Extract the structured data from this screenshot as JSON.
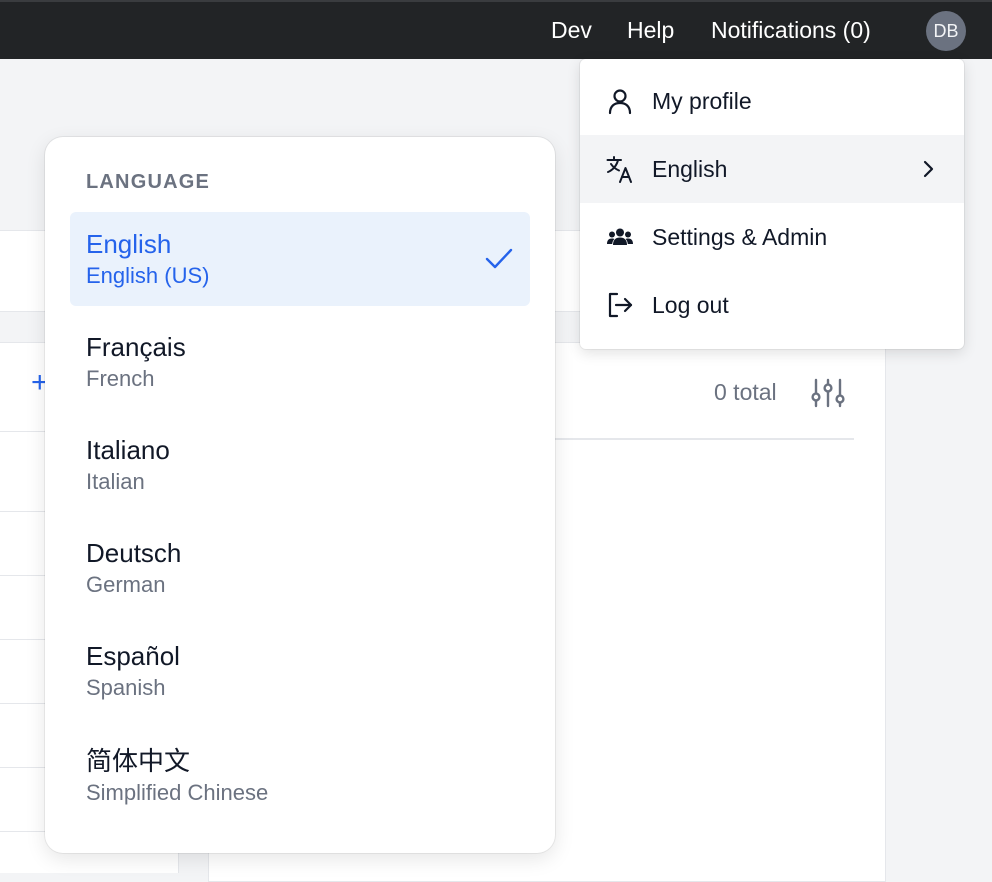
{
  "topbar": {
    "links": [
      "Dev",
      "Help",
      "Notifications (0)"
    ],
    "avatar_initials": "DB"
  },
  "background": {
    "total_label": "0 total",
    "add_symbol": "+"
  },
  "account_menu": {
    "items": [
      {
        "label": "My profile",
        "icon": "person-icon"
      },
      {
        "label": "English",
        "icon": "translate-icon"
      },
      {
        "label": "Settings & Admin",
        "icon": "users-icon"
      },
      {
        "label": "Log out",
        "icon": "logout-icon"
      }
    ]
  },
  "language_menu": {
    "heading": "LANGUAGE",
    "options": [
      {
        "native": "English",
        "english": "English (US)",
        "selected": true
      },
      {
        "native": "Français",
        "english": "French"
      },
      {
        "native": "Italiano",
        "english": "Italian"
      },
      {
        "native": "Deutsch",
        "english": "German"
      },
      {
        "native": "Español",
        "english": "Spanish"
      },
      {
        "native": "简体中文",
        "english": "Simplified Chinese"
      }
    ]
  },
  "colors": {
    "topbar": "#222426",
    "accent": "#2563eb",
    "selected_bg": "#eaf2fc",
    "muted_text": "#6b7280"
  }
}
